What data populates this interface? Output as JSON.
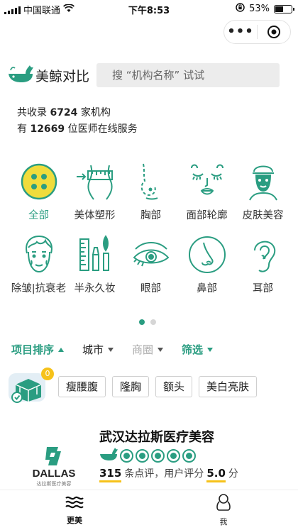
{
  "status_bar": {
    "carrier": "中国联通",
    "time": "下午8:53",
    "battery": "53%",
    "battery_level": 0.53
  },
  "capsule": {
    "more_icon": "more-dots-icon",
    "close_icon": "target-close-icon"
  },
  "header": {
    "app_name": "美鲸对比",
    "search_placeholder": "搜 “机构名称” 试试"
  },
  "stats": {
    "line1_prefix": "共收录 ",
    "institutions": "6724",
    "line1_suffix": " 家机构",
    "line2_prefix": "有 ",
    "doctors": "12669",
    "line2_suffix": " 位医师在线服务"
  },
  "categories": [
    {
      "label": "全部",
      "icon": "grid-dots-icon"
    },
    {
      "label": "美体塑形",
      "icon": "body-measure-icon"
    },
    {
      "label": "胸部",
      "icon": "chest-icon"
    },
    {
      "label": "面部轮廓",
      "icon": "face-contour-icon"
    },
    {
      "label": "皮肤美容",
      "icon": "face-mask-icon"
    },
    {
      "label": "除皱|抗衰老",
      "icon": "wrinkle-face-icon"
    },
    {
      "label": "半永久妆",
      "icon": "makeup-brush-icon"
    },
    {
      "label": "眼部",
      "icon": "eye-icon"
    },
    {
      "label": "鼻部",
      "icon": "nose-icon"
    },
    {
      "label": "耳部",
      "icon": "ear-icon"
    }
  ],
  "pager": {
    "total": 2,
    "current": 1
  },
  "filters": {
    "sort": "项目排序",
    "city": "城市",
    "district": "商圈",
    "screen": "筛选"
  },
  "coupon_badge": "0",
  "tags": [
    "瘦腰腹",
    "隆胸",
    "额头",
    "美白亮肤"
  ],
  "listing": {
    "name": "武汉达拉斯医疗美容",
    "logo_text": "DALLAS",
    "logo_sub": "达拉斯医疗美容",
    "rating_level": 5,
    "reviews_count": "315",
    "reviews_text": "条点评，用户评分",
    "score": "5.0",
    "score_unit": "分"
  },
  "tabbar": [
    {
      "label": "更美",
      "icon": "waves-home-icon"
    },
    {
      "label": "我",
      "icon": "person-icon"
    }
  ],
  "colors": {
    "accent": "#2a9d81",
    "highlight": "#f6c21a"
  }
}
